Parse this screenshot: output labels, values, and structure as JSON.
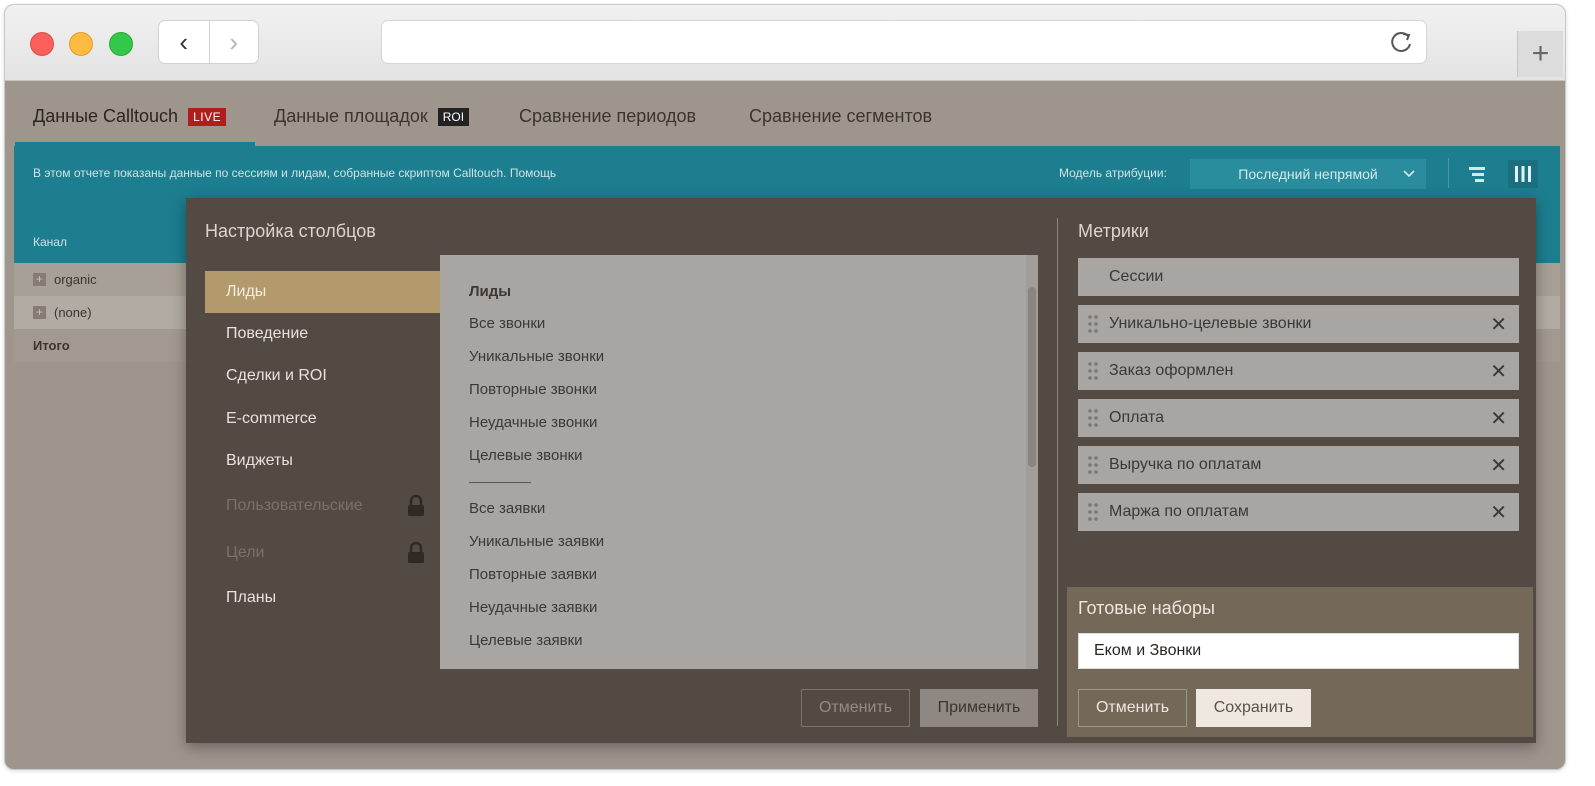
{
  "browser": {
    "back_glyph": "‹",
    "forward_glyph": "›",
    "newtab_glyph": "+"
  },
  "tabs": [
    {
      "label": "Данные Calltouch",
      "badge": "LIVE"
    },
    {
      "label": "Данные площадок",
      "badge": "ROI"
    },
    {
      "label": "Сравнение периодов"
    },
    {
      "label": "Сравнение сегментов"
    }
  ],
  "infobar": {
    "text": "В этом отчете показаны данные по сессиям и лидам, собранные скриптом Calltouch. Помощь",
    "attribution_label": "Модель атрибуции:",
    "attribution_value": "Последний непрямой"
  },
  "table": {
    "header": "Канал",
    "rows": [
      {
        "plus": "+",
        "label": "organic"
      },
      {
        "plus": "+",
        "label": "(none)"
      }
    ],
    "total": "Итого"
  },
  "modal": {
    "title": "Настройка столбцов",
    "categories": [
      {
        "label": "Лиды",
        "active": true
      },
      {
        "label": "Поведение"
      },
      {
        "label": "Сделки и ROI"
      },
      {
        "label": "E-commerce"
      },
      {
        "label": "Виджеты"
      },
      {
        "label": "Пользовательские",
        "locked": true
      },
      {
        "label": "Цели",
        "locked": true
      },
      {
        "label": "Планы"
      }
    ],
    "list": {
      "heading": "Лиды",
      "group1": [
        "Все звонки",
        "Уникальные звонки",
        "Повторные звонки",
        "Неудачные звонки",
        "Целевые звонки"
      ],
      "group2": [
        "Все заявки",
        "Уникальные заявки",
        "Повторные заявки",
        "Неудачные заявки",
        "Целевые заявки"
      ]
    },
    "cancel_label": "Отменить",
    "apply_label": "Применить",
    "metrics_title": "Метрики",
    "metrics": [
      {
        "label": "Сессии",
        "removable": false
      },
      {
        "label": "Уникально-целевые звонки",
        "removable": true
      },
      {
        "label": "Заказ оформлен",
        "removable": true
      },
      {
        "label": "Оплата",
        "removable": true
      },
      {
        "label": "Выручка по оплатам",
        "removable": true
      },
      {
        "label": "Маржа по оплатам",
        "removable": true
      }
    ],
    "remove_glyph": "✕",
    "presets": {
      "title": "Готовые наборы",
      "input_value": "Еком и Звонки",
      "cancel_label": "Отменить",
      "save_label": "Сохранить"
    }
  },
  "colors": {
    "teal": "#1c7e8f",
    "modal_bg": "#534a43",
    "active_category": "#b39a6c",
    "live_badge": "#b31c1c"
  }
}
